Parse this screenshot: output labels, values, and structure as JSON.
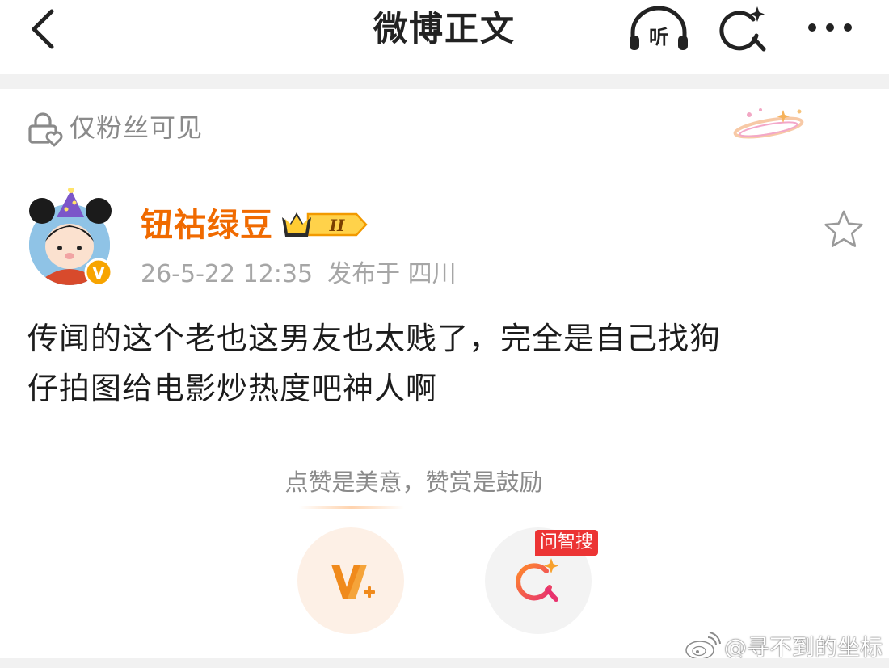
{
  "header": {
    "title": "微博正文",
    "listen_label": "听"
  },
  "visibility": {
    "text": "仅粉丝可见"
  },
  "post": {
    "author": "钮祜绿豆",
    "vip_level": "II",
    "time": "26-5-22 12:35",
    "location": "发布于 四川",
    "text_lines": [
      "传闻的这个老也这男友也太贱了，完全是自己找狗",
      "仔拍图给电影炒热度吧神人啊"
    ]
  },
  "reward": {
    "tip": "点赞是美意，赞赏是鼓励",
    "ask_badge": "问智搜"
  },
  "watermark": {
    "text": "@寻不到的坐标"
  },
  "colors": {
    "accent_orange": "#f06a00",
    "badge_red": "#ec3434",
    "muted_gray": "#8a8a8a"
  }
}
